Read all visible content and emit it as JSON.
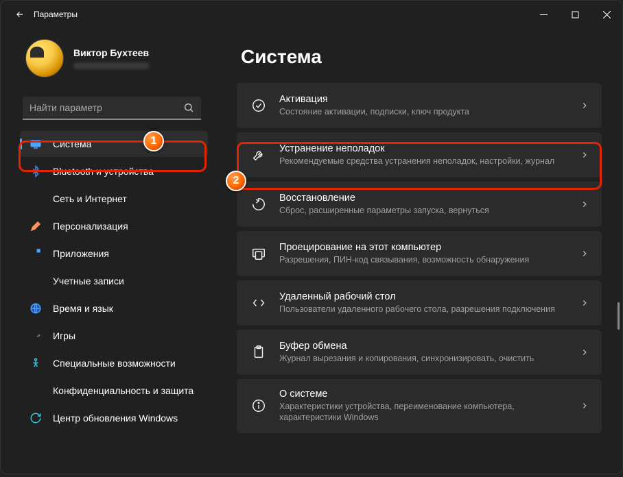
{
  "window": {
    "title": "Параметры"
  },
  "profile": {
    "name": "Виктор Бухтеев"
  },
  "search": {
    "placeholder": "Найти параметр"
  },
  "page": {
    "title": "Система"
  },
  "nav": [
    {
      "label": "Система",
      "icon": "system",
      "active": true
    },
    {
      "label": "Bluetooth и устройства",
      "icon": "bluetooth"
    },
    {
      "label": "Сеть и Интернет",
      "icon": "wifi"
    },
    {
      "label": "Персонализация",
      "icon": "brush"
    },
    {
      "label": "Приложения",
      "icon": "apps"
    },
    {
      "label": "Учетные записи",
      "icon": "user"
    },
    {
      "label": "Время и язык",
      "icon": "globe"
    },
    {
      "label": "Игры",
      "icon": "game"
    },
    {
      "label": "Специальные возможности",
      "icon": "access"
    },
    {
      "label": "Конфиденциальность и защита",
      "icon": "shield"
    },
    {
      "label": "Центр обновления Windows",
      "icon": "update"
    }
  ],
  "cards": [
    {
      "icon": "activation",
      "title": "Активация",
      "sub": "Состояние активации, подписки, ключ продукта"
    },
    {
      "icon": "troubleshoot",
      "title": "Устранение неполадок",
      "sub": "Рекомендуемые средства устранения неполадок, настройки, журнал"
    },
    {
      "icon": "recovery",
      "title": "Восстановление",
      "sub": "Сброс, расширенные параметры запуска, вернуться"
    },
    {
      "icon": "projecting",
      "title": "Проецирование на этот компьютер",
      "sub": "Разрешения, ПИН-код связывания, возможность обнаружения"
    },
    {
      "icon": "remote",
      "title": "Удаленный рабочий стол",
      "sub": "Пользователи удаленного рабочего стола, разрешения подключения"
    },
    {
      "icon": "clipboard",
      "title": "Буфер обмена",
      "sub": "Журнал вырезания и копирования, синхронизировать, очистить"
    },
    {
      "icon": "about",
      "title": "О системе",
      "sub": "Характеристики устройства, переименование компьютера, характеристики Windows"
    }
  ],
  "badges": {
    "one": "1",
    "two": "2"
  }
}
